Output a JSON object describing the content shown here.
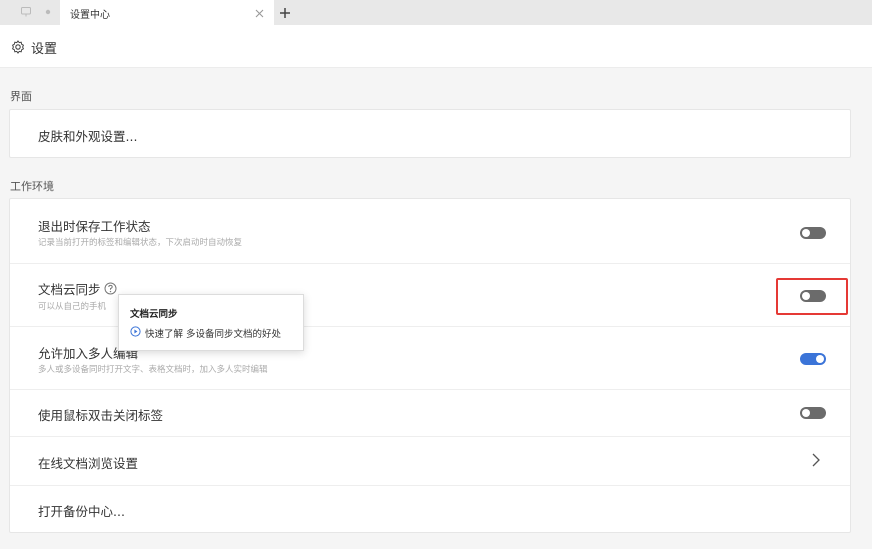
{
  "tabbar": {
    "tab_title": "设置中心",
    "icons": [
      "window-icon",
      "dot-icon",
      "close-icon",
      "plus-icon"
    ]
  },
  "header": {
    "title": "设置",
    "icon": "gear-icon"
  },
  "sections": {
    "interface": {
      "label": "界面",
      "items": [
        {
          "title": "皮肤和外观设置..."
        }
      ]
    },
    "workspace": {
      "label": "工作环境",
      "items": [
        {
          "title": "退出时保存工作状态",
          "desc": "记录当前打开的标签和编辑状态，下次启动时自动恢复",
          "toggle": "off"
        },
        {
          "title": "文档云同步",
          "desc": "可以从自己的手机",
          "toggle": "off",
          "help_icon": "help-circle-icon"
        },
        {
          "title": "允许加入多人编辑",
          "desc": "多人或多设备同时打开文字、表格文档时，加入多人实时编辑",
          "toggle": "on"
        },
        {
          "title": "使用鼠标双击关闭标签",
          "toggle": "off"
        },
        {
          "title": "在线文档浏览设置",
          "action": "chevron-right-icon"
        },
        {
          "title": "打开备份中心..."
        }
      ]
    }
  },
  "tooltip": {
    "title": "文档云同步",
    "link_text": "快速了解 多设备同步文档的好处",
    "icon": "play-circle-icon"
  },
  "colors": {
    "toggle_off": "#6b6b6b",
    "toggle_on": "#3b74d8",
    "highlight": "#e53935"
  }
}
